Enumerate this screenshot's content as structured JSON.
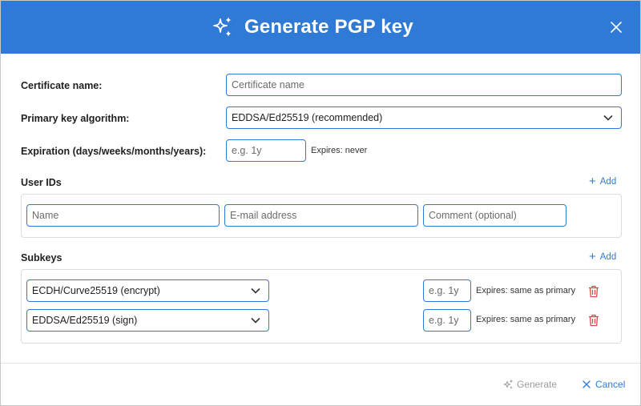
{
  "dialog": {
    "title": "Generate PGP key",
    "title_icon": "sparkle-icon",
    "close_icon": "close-icon"
  },
  "certificate": {
    "label": "Certificate name:",
    "placeholder": "Certificate name",
    "value": ""
  },
  "algorithm": {
    "label": "Primary key algorithm:",
    "selected": "EDDSA/Ed25519 (recommended)"
  },
  "expiration": {
    "label": "Expiration (days/weeks/months/years):",
    "placeholder": "e.g. 1y",
    "value": "",
    "status": "Expires: never"
  },
  "user_ids": {
    "label": "User IDs",
    "add_label": "Add",
    "name_placeholder": "Name",
    "email_placeholder": "E-mail address",
    "comment_placeholder": "Comment (optional)"
  },
  "subkeys": {
    "label": "Subkeys",
    "add_label": "Add",
    "items": [
      {
        "algorithm": "ECDH/Curve25519 (encrypt)",
        "expiration_placeholder": "e.g. 1y",
        "status": "Expires: same as primary"
      },
      {
        "algorithm": "EDDSA/Ed25519 (sign)",
        "expiration_placeholder": "e.g. 1y",
        "status": "Expires: same as primary"
      }
    ]
  },
  "footer": {
    "generate_label": "Generate",
    "cancel_label": "Cancel"
  },
  "colors": {
    "accent": "#2f7ad6",
    "danger": "#e0454b",
    "disabled": "#9c9c9c"
  }
}
